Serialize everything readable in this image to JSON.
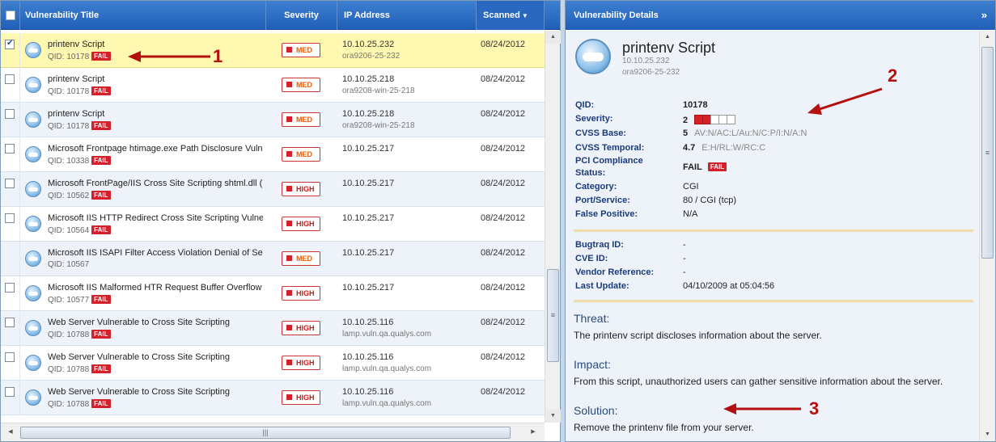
{
  "grid": {
    "headers": {
      "title": "Vulnerability Title",
      "severity": "Severity",
      "ip": "IP Address",
      "scanned": "Scanned",
      "sort_icon": "sort-descending-icon"
    },
    "rows": [
      {
        "checked": true,
        "title": "printenv Script",
        "qid": "QID: 10178",
        "fail": "FAIL",
        "severity": "MED",
        "ip": "10.10.25.232",
        "host": "ora9206-25-232",
        "scanned": "08/24/2012"
      },
      {
        "checked": false,
        "title": "printenv Script",
        "qid": "QID: 10178",
        "fail": "FAIL",
        "severity": "MED",
        "ip": "10.10.25.218",
        "host": "ora9208-win-25-218",
        "scanned": "08/24/2012"
      },
      {
        "checked": false,
        "title": "printenv Script",
        "qid": "QID: 10178",
        "fail": "FAIL",
        "severity": "MED",
        "ip": "10.10.25.218",
        "host": "ora9208-win-25-218",
        "scanned": "08/24/2012"
      },
      {
        "checked": false,
        "title": "Microsoft Frontpage htimage.exe Path Disclosure Vulne",
        "qid": "QID: 10338",
        "fail": "FAIL",
        "severity": "MED",
        "ip": "10.10.25.217",
        "host": "",
        "scanned": "08/24/2012"
      },
      {
        "checked": false,
        "title": "Microsoft FrontPage/IIS Cross Site Scripting shtml.dll (M",
        "qid": "QID: 10562",
        "fail": "FAIL",
        "severity": "HIGH",
        "ip": "10.10.25.217",
        "host": "",
        "scanned": "08/24/2012"
      },
      {
        "checked": false,
        "title": "Microsoft IIS HTTP Redirect Cross Site Scripting Vulnera",
        "qid": "QID: 10564",
        "fail": "FAIL",
        "severity": "HIGH",
        "ip": "10.10.25.217",
        "host": "",
        "scanned": "08/24/2012"
      },
      {
        "checked": null,
        "title": "Microsoft IIS ISAPI Filter Access Violation Denial of Serv",
        "qid": "QID: 10567",
        "fail": "",
        "severity": "MED",
        "ip": "10.10.25.217",
        "host": "",
        "scanned": "08/24/2012"
      },
      {
        "checked": false,
        "title": "Microsoft IIS Malformed HTR Request Buffer Overflow V",
        "qid": "QID: 10577",
        "fail": "FAIL",
        "severity": "HIGH",
        "ip": "10.10.25.217",
        "host": "",
        "scanned": "08/24/2012"
      },
      {
        "checked": false,
        "title": "Web Server Vulnerable to Cross Site Scripting",
        "qid": "QID: 10788",
        "fail": "FAIL",
        "severity": "HIGH",
        "ip": "10.10.25.116",
        "host": "lamp.vuln.qa.qualys.com",
        "scanned": "08/24/2012"
      },
      {
        "checked": false,
        "title": "Web Server Vulnerable to Cross Site Scripting",
        "qid": "QID: 10788",
        "fail": "FAIL",
        "severity": "HIGH",
        "ip": "10.10.25.116",
        "host": "lamp.vuln.qa.qualys.com",
        "scanned": "08/24/2012"
      },
      {
        "checked": false,
        "title": "Web Server Vulnerable to Cross Site Scripting",
        "qid": "QID: 10788",
        "fail": "FAIL",
        "severity": "HIGH",
        "ip": "10.10.25.116",
        "host": "lamp.vuln.qa.qualys.com",
        "scanned": "08/24/2012"
      }
    ]
  },
  "details": {
    "panel_title": "Vulnerability Details",
    "collapse_label": "»",
    "title": "printenv Script",
    "ip": "10.10.25.232",
    "host": "ora9206-25-232",
    "fields": {
      "qid_label": "QID:",
      "qid": "10178",
      "severity_label": "Severity:",
      "severity": "2",
      "severity_level": 2,
      "severity_max": 5,
      "cvss_base_label": "CVSS Base:",
      "cvss_base": "5",
      "cvss_base_vector": "AV:N/AC:L/Au:N/C:P/I:N/A:N",
      "cvss_temporal_label": "CVSS Temporal:",
      "cvss_temporal": "4.7",
      "cvss_temporal_vector": "E:H/RL:W/RC:C",
      "pci_label_1": "PCI Compliance",
      "pci_label_2": "Status:",
      "pci": "FAIL",
      "pci_badge": "FAIL",
      "category_label": "Category:",
      "category": "CGI",
      "port_label": "Port/Service:",
      "port": "80 / CGI (tcp)",
      "false_positive_label": "False Positive:",
      "false_positive": "N/A",
      "bugtraq_label": "Bugtraq ID:",
      "bugtraq": "-",
      "cve_label": "CVE ID:",
      "cve": "-",
      "vendor_label": "Vendor Reference:",
      "vendor": "-",
      "last_update_label": "Last Update:",
      "last_update": "04/10/2009 at 05:04:56"
    },
    "threat_title": "Threat:",
    "threat": "The printenv script discloses information about the server.",
    "impact_title": "Impact:",
    "impact": "From this script, unauthorized users can gather sensitive information about the server.",
    "solution_title": "Solution:",
    "solution": "Remove the printenv file from your server."
  },
  "annotations": [
    "1",
    "2",
    "3"
  ],
  "colors": {
    "accent": "#1f5fb8",
    "fail": "#d4202a",
    "annotation": "#b51010",
    "selected_row": "#fff8b0"
  }
}
